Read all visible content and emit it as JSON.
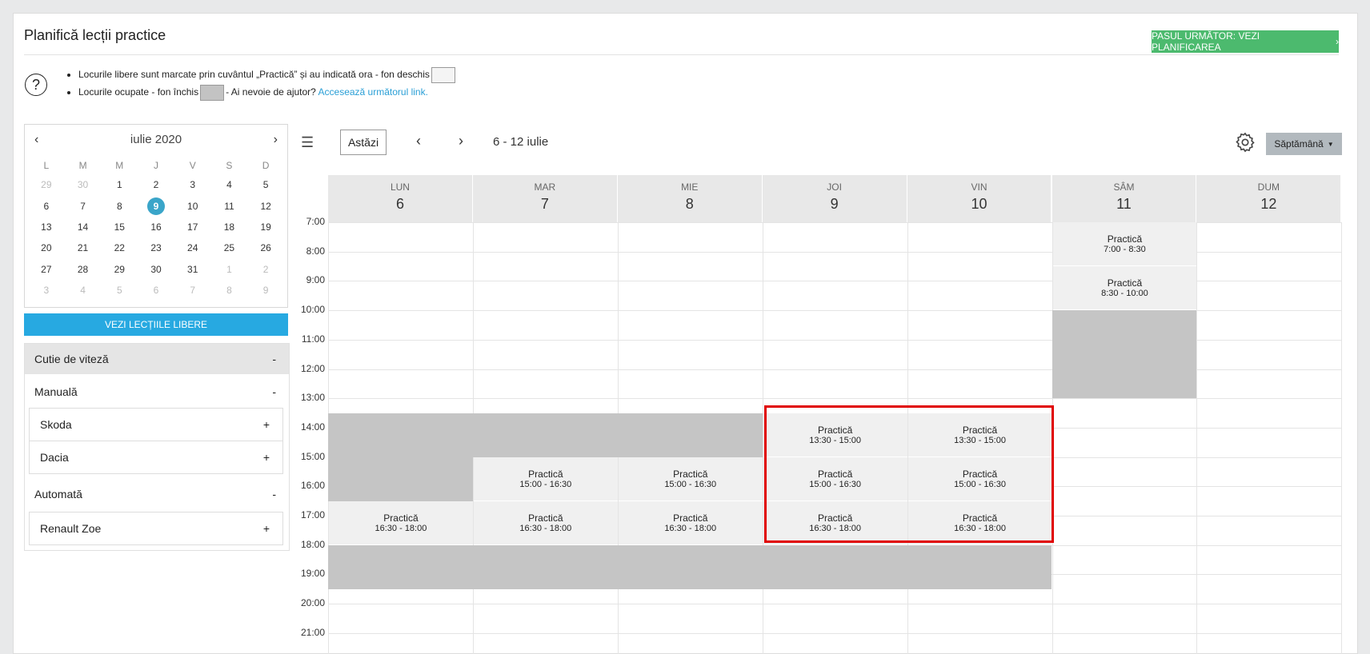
{
  "page": {
    "title": "Planifică lecții practice",
    "next_button": "PASUL URMĂTOR: VEZI PLANIFICAREA",
    "info_line1": "Locurile libere sunt marcate prin cuvântul „Practică” și au indicată ora - fon deschis",
    "info_line2_a": "Locurile ocupate - fon închis",
    "info_line2_b": "- Ai nevoie de ajutor?",
    "info_link": "Accesează următorul link."
  },
  "mini_calendar": {
    "month": "iulie 2020",
    "dow": [
      "L",
      "M",
      "M",
      "J",
      "V",
      "S",
      "D"
    ],
    "days": [
      [
        "29",
        "30",
        "1",
        "2",
        "3",
        "4",
        "5"
      ],
      [
        "6",
        "7",
        "8",
        "9",
        "10",
        "11",
        "12"
      ],
      [
        "13",
        "14",
        "15",
        "16",
        "17",
        "18",
        "19"
      ],
      [
        "20",
        "21",
        "22",
        "23",
        "24",
        "25",
        "26"
      ],
      [
        "27",
        "28",
        "29",
        "30",
        "31",
        "1",
        "2"
      ],
      [
        "3",
        "4",
        "5",
        "6",
        "7",
        "8",
        "9"
      ]
    ],
    "selected": "9"
  },
  "free_lessons_button": "VEZI LECȚIILE LIBERE",
  "filters": {
    "gearbox": {
      "label": "Cutie de viteză",
      "toggle": "-"
    },
    "manual": {
      "label": "Manuală",
      "toggle": "-"
    },
    "manual_cars": [
      {
        "label": "Skoda",
        "toggle": "+"
      },
      {
        "label": "Dacia",
        "toggle": "+"
      }
    ],
    "automatic": {
      "label": "Automată",
      "toggle": "-"
    },
    "automatic_cars": [
      {
        "label": "Renault Zoe",
        "toggle": "+"
      }
    ]
  },
  "toolbar": {
    "today": "Astăzi",
    "range": "6 - 12 iulie",
    "view": "Săptămână"
  },
  "week": {
    "days": [
      {
        "name": "LUN",
        "num": "6"
      },
      {
        "name": "MAR",
        "num": "7"
      },
      {
        "name": "MIE",
        "num": "8"
      },
      {
        "name": "JOI",
        "num": "9"
      },
      {
        "name": "VIN",
        "num": "10"
      },
      {
        "name": "SÂM",
        "num": "11"
      },
      {
        "name": "DUM",
        "num": "12"
      }
    ],
    "hours": [
      "7:00",
      "8:00",
      "9:00",
      "10:00",
      "11:00",
      "12:00",
      "13:00",
      "14:00",
      "15:00",
      "16:00",
      "17:00",
      "18:00",
      "19:00",
      "20:00",
      "21:00"
    ],
    "slot_label": "Practică",
    "slots": [
      {
        "day": 5,
        "time": "7:00 - 8:30"
      },
      {
        "day": 5,
        "time": "8:30 - 10:00"
      },
      {
        "day": 3,
        "time": "13:30 - 15:00"
      },
      {
        "day": 4,
        "time": "13:30 - 15:00"
      },
      {
        "day": 1,
        "time": "15:00 - 16:30"
      },
      {
        "day": 2,
        "time": "15:00 - 16:30"
      },
      {
        "day": 3,
        "time": "15:00 - 16:30"
      },
      {
        "day": 4,
        "time": "15:00 - 16:30"
      },
      {
        "day": 0,
        "time": "16:30 - 18:00"
      },
      {
        "day": 1,
        "time": "16:30 - 18:00"
      },
      {
        "day": 2,
        "time": "16:30 - 18:00"
      },
      {
        "day": 3,
        "time": "16:30 - 18:00"
      },
      {
        "day": 4,
        "time": "16:30 - 18:00"
      }
    ],
    "busy": [
      {
        "day": 5,
        "from": "10:00",
        "to": "13:00"
      },
      {
        "day": 0,
        "from": "13:30",
        "to": "16:30"
      },
      {
        "day": 1,
        "from": "13:30",
        "to": "15:00"
      },
      {
        "day": 2,
        "from": "13:30",
        "to": "15:00"
      },
      {
        "day": 0,
        "from": "18:00",
        "to": "19:30"
      },
      {
        "day": 1,
        "from": "18:00",
        "to": "19:30"
      },
      {
        "day": 2,
        "from": "18:00",
        "to": "19:30"
      },
      {
        "day": 3,
        "from": "18:00",
        "to": "19:30"
      },
      {
        "day": 4,
        "from": "18:00",
        "to": "19:30"
      }
    ]
  }
}
